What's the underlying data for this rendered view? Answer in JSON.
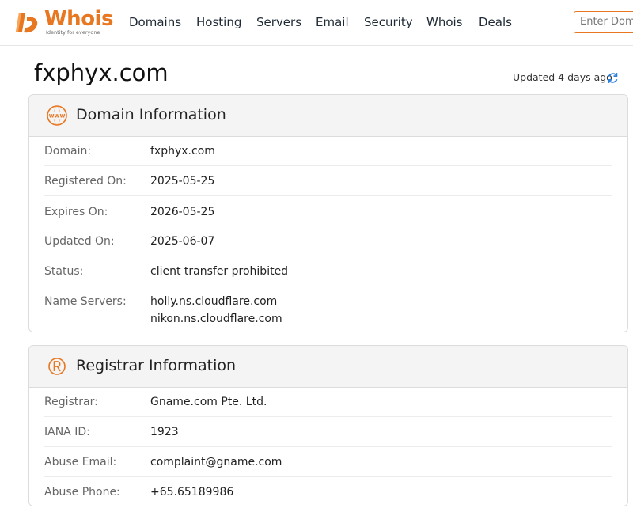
{
  "brand": {
    "name": "Whois",
    "tagline": "Identity for everyone",
    "accent": "#e87722"
  },
  "nav": [
    "Domains",
    "Hosting",
    "Servers",
    "Email",
    "Security",
    "Whois",
    "Deals"
  ],
  "search": {
    "placeholder": "Enter Dom"
  },
  "page": {
    "title": "fxphyx.com",
    "updated": "Updated 4 days ago"
  },
  "domain_info": {
    "title": "Domain Information",
    "icon_text": "www",
    "rows": [
      {
        "label": "Domain:",
        "value": "fxphyx.com"
      },
      {
        "label": "Registered On:",
        "value": "2025-05-25"
      },
      {
        "label": "Expires On:",
        "value": "2026-05-25"
      },
      {
        "label": "Updated On:",
        "value": "2025-06-07"
      },
      {
        "label": "Status:",
        "value": "client transfer prohibited"
      },
      {
        "label": "Name Servers:",
        "values": [
          "holly.ns.cloudflare.com",
          "nikon.ns.cloudflare.com"
        ]
      }
    ]
  },
  "registrar_info": {
    "title": "Registrar Information",
    "rows": [
      {
        "label": "Registrar:",
        "value": "Gname.com Pte. Ltd."
      },
      {
        "label": "IANA ID:",
        "value": "1923"
      },
      {
        "label": "Abuse Email:",
        "value": "complaint@gname.com"
      },
      {
        "label": "Abuse Phone:",
        "value": "+65.65189986"
      }
    ]
  }
}
